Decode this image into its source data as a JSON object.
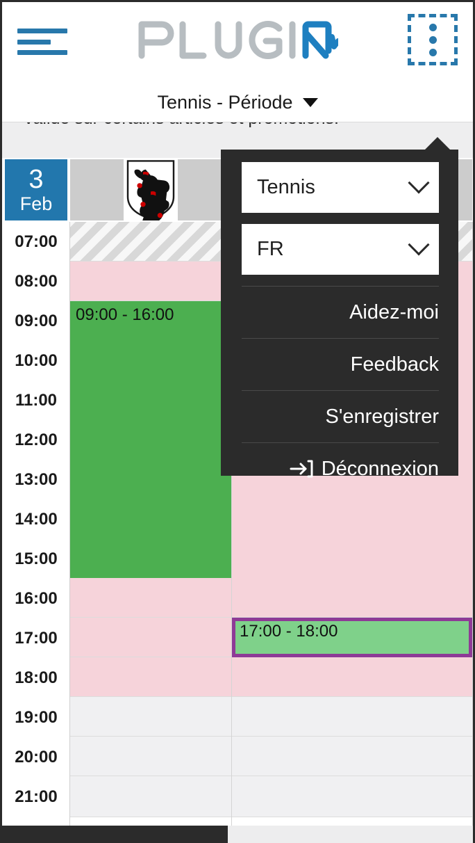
{
  "header": {
    "menu_icon": "hamburger-icon",
    "logo_text": "PLUGIN",
    "logo_prefix": "PLUGI",
    "logo_suffix": "N",
    "overflow_icon": "three-dots-vertical-icon",
    "brand_blue": "#2878ab",
    "brand_gray": "#b7bdc1"
  },
  "subtitle": {
    "title": "Tennis - Période",
    "chevron_icon": "chevron-down-icon"
  },
  "promo": {
    "text": "valide sur certains articles et promotions."
  },
  "calendar": {
    "date_badge": {
      "day": "3",
      "month": "Feb",
      "color": "#2277ad"
    },
    "columns": [
      {
        "id": "court-1",
        "crest_icon": "appenzell-bear-crest-icon"
      },
      {
        "id": "court-2",
        "crest_icon": ""
      }
    ],
    "time_labels": [
      "07:00",
      "08:00",
      "09:00",
      "10:00",
      "11:00",
      "12:00",
      "13:00",
      "14:00",
      "15:00",
      "16:00",
      "17:00",
      "18:00",
      "19:00",
      "20:00",
      "21:00"
    ],
    "legend_colors": {
      "available_event": "#4caf50",
      "booked_event": "#7fd18a",
      "booked_border": "#8e3a96",
      "closed": "#f6d3da",
      "free": "#f0f0f2",
      "hatched": "#d8d8d8"
    },
    "column_1": {
      "hatched": {
        "start": "07:00",
        "end": "08:00"
      },
      "closed_before": {
        "start": "08:00",
        "end": "09:00"
      },
      "event": {
        "label": "09:00 - 16:00",
        "start": "09:00",
        "end": "16:00"
      },
      "closed_after": {
        "start": "16:00",
        "end": "19:00"
      },
      "free": {
        "start": "19:00",
        "end": "22:00"
      }
    },
    "column_2": {
      "hatched": {
        "start": "07:00",
        "end": "08:00"
      },
      "closed_before": {
        "start": "08:00",
        "end": "17:00"
      },
      "event": {
        "label": "17:00 - 18:00",
        "start": "17:00",
        "end": "18:00"
      },
      "closed_after": {
        "start": "18:00",
        "end": "19:00"
      },
      "free": {
        "start": "19:00",
        "end": "22:00"
      }
    }
  },
  "menu": {
    "sport_select": {
      "value": "Tennis",
      "chevron_icon": "chevron-down-icon"
    },
    "language_select": {
      "value": "FR",
      "chevron_icon": "chevron-down-icon"
    },
    "items": [
      {
        "label": "Aidez-moi",
        "icon": ""
      },
      {
        "label": "Feedback",
        "icon": ""
      },
      {
        "label": "S'enregistrer",
        "icon": ""
      },
      {
        "label": "Déconnexion",
        "icon": "logout-arrow-icon"
      }
    ]
  }
}
